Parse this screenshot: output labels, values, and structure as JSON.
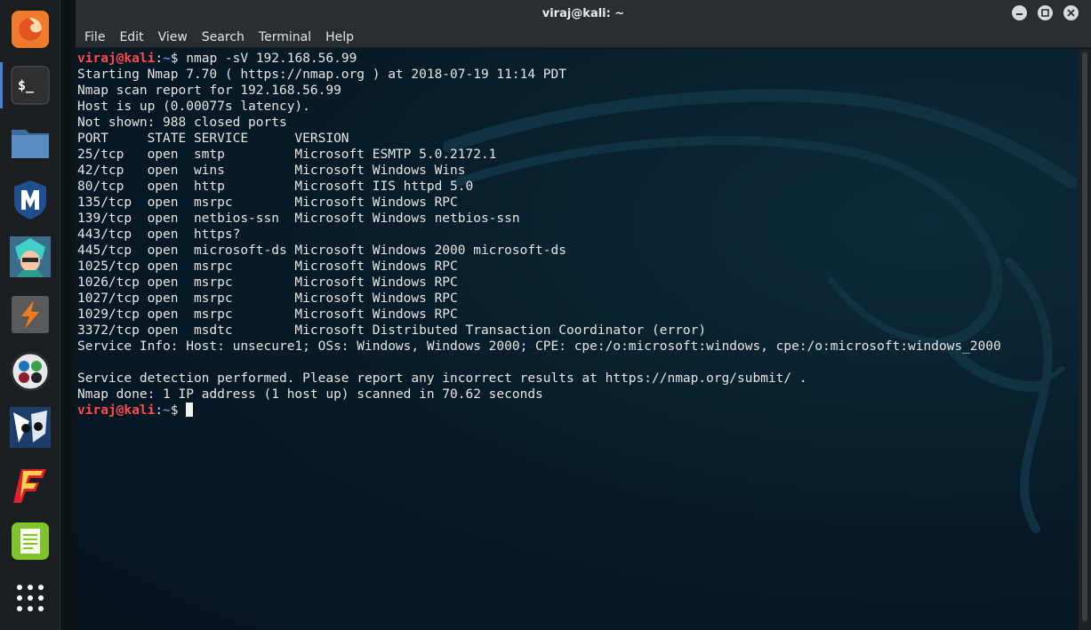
{
  "window": {
    "title": "viraj@kali: ~"
  },
  "menu": [
    "File",
    "Edit",
    "View",
    "Search",
    "Terminal",
    "Help"
  ],
  "dock": [
    {
      "name": "firefox-icon"
    },
    {
      "name": "terminal-icon",
      "label": "$_"
    },
    {
      "name": "files-icon"
    },
    {
      "name": "metasploit-icon"
    },
    {
      "name": "armitage-icon"
    },
    {
      "name": "burpsuite-icon"
    },
    {
      "name": "maltego-icon"
    },
    {
      "name": "beef-icon"
    },
    {
      "name": "faraday-icon"
    },
    {
      "name": "leafpad-icon"
    },
    {
      "name": "show-apps-icon"
    }
  ],
  "prompt": {
    "user": "viraj@kali",
    "colon": ":",
    "path": "~",
    "symbol": "$ "
  },
  "command": "nmap -sV 192.168.56.99",
  "output": [
    "Starting Nmap 7.70 ( https://nmap.org ) at 2018-07-19 11:14 PDT",
    "Nmap scan report for 192.168.56.99",
    "Host is up (0.00077s latency).",
    "Not shown: 988 closed ports",
    "PORT     STATE SERVICE      VERSION",
    "25/tcp   open  smtp         Microsoft ESMTP 5.0.2172.1",
    "42/tcp   open  wins         Microsoft Windows Wins",
    "80/tcp   open  http         Microsoft IIS httpd 5.0",
    "135/tcp  open  msrpc        Microsoft Windows RPC",
    "139/tcp  open  netbios-ssn  Microsoft Windows netbios-ssn",
    "443/tcp  open  https?",
    "445/tcp  open  microsoft-ds Microsoft Windows 2000 microsoft-ds",
    "1025/tcp open  msrpc        Microsoft Windows RPC",
    "1026/tcp open  msrpc        Microsoft Windows RPC",
    "1027/tcp open  msrpc        Microsoft Windows RPC",
    "1029/tcp open  msrpc        Microsoft Windows RPC",
    "3372/tcp open  msdtc        Microsoft Distributed Transaction Coordinator (error)",
    "Service Info: Host: unsecure1; OSs: Windows, Windows 2000; CPE: cpe:/o:microsoft:windows, cpe:/o:microsoft:windows_2000",
    "",
    "Service detection performed. Please report any incorrect results at https://nmap.org/submit/ .",
    "Nmap done: 1 IP address (1 host up) scanned in 70.62 seconds"
  ],
  "colors": {
    "prompt_user": "#ff4b4b",
    "prompt_path": "#5e8ad6",
    "terminal_bg": "#071a26",
    "text": "#e6e6e6"
  }
}
